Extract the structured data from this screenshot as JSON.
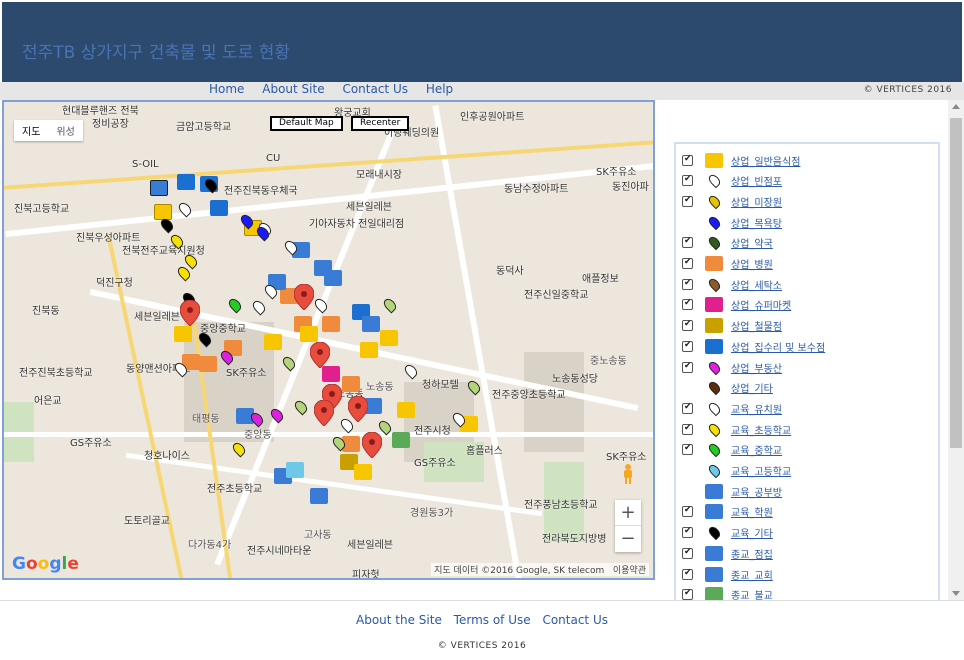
{
  "header": {
    "title": "전주TB 상가지구 건축물 및 도로 현황",
    "bg_color": "#2c4a6e",
    "title_color": "#4a73b5"
  },
  "nav": {
    "items": [
      "Home",
      "About Site",
      "Contact Us",
      "Help"
    ],
    "copyright": "© VERTICES 2016"
  },
  "map": {
    "type_options": [
      "지도",
      "위성"
    ],
    "buttons": {
      "default_map": "Default Map",
      "recenter": "Recenter"
    },
    "labels": [
      "현대블루핸즈 전북",
      "정비공장",
      "금암고등학교",
      "CU",
      "S-OIL",
      "전주진북동우체국",
      "진북고등학교",
      "진북우성아파트",
      "전북전주교육지원청",
      "기아자동차 전일대리점",
      "세븐일레븐",
      "덕진구청",
      "진북동",
      "세븐일레븐",
      "중앙중학교",
      "전주진북초등학교",
      "동양맨션아파트",
      "SK주유소",
      "어은교",
      "GS주유소",
      "청호나이스",
      "태평동",
      "중앙동",
      "전주초등학교",
      "도토리골교",
      "다가동4가",
      "전주시네마타운",
      "고사동",
      "세븐일레븐",
      "피자헛",
      "인후공원아파트",
      "왕궁교회",
      "이랑웨딩의원",
      "SK주유소",
      "동진아파",
      "모래내시장",
      "동남수정아파트",
      "동덕사",
      "애플정보",
      "전주신일중학교",
      "노송동",
      "중노송동",
      "노송동성당",
      "전주중앙초등학교",
      "청하모텔",
      "전주시청",
      "홈플러스",
      "GS주유소",
      "SK주유소",
      "경원동3가",
      "전주풍남초등학교",
      "전라북도지방병",
      "노송동"
    ],
    "attribution": "지도 데이터 ©2016 Google, SK telecom",
    "terms": "이용약관",
    "logo": "Google",
    "zoom_in": "+",
    "zoom_out": "−"
  },
  "legend": {
    "items": [
      {
        "label": "상업_일반음식점",
        "checked": true,
        "icon": "korean-flag-icon",
        "color": "#f7c600"
      },
      {
        "label": "상업_빈점포",
        "checked": true,
        "icon": "white-pin-icon",
        "color": "#ffffff"
      },
      {
        "label": "상업_미장원",
        "checked": true,
        "icon": "yellow-pin-icon",
        "color": "#e6c200"
      },
      {
        "label": "상업_목욕탕",
        "checked": false,
        "icon": "blue-pin-icon",
        "color": "#1a1aff"
      },
      {
        "label": "상업_약국",
        "checked": true,
        "icon": "darkgreen-pin-icon",
        "color": "#2e5d1e"
      },
      {
        "label": "상업_병원",
        "checked": true,
        "icon": "hospital-icon",
        "color": "#f08a3c"
      },
      {
        "label": "상업_세탁소",
        "checked": true,
        "icon": "brown-pin-icon",
        "color": "#8b5a2b"
      },
      {
        "label": "상업_슈퍼마켓",
        "checked": true,
        "icon": "supermarket-icon",
        "color": "#e0208c"
      },
      {
        "label": "상업_철물점",
        "checked": true,
        "icon": "hardware-icon",
        "color": "#c8a000"
      },
      {
        "label": "상업_집수리 및 보수점",
        "checked": true,
        "icon": "house-repair-icon",
        "color": "#1a6fd1"
      },
      {
        "label": "상업_부동산",
        "checked": true,
        "icon": "magenta-pin-icon",
        "color": "#e020e0"
      },
      {
        "label": "상업_기타",
        "checked": false,
        "icon": "darkbrown-pin-icon",
        "color": "#5a2d0c"
      },
      {
        "label": "교육_유치원",
        "checked": true,
        "icon": "white-pin-icon",
        "color": "#ffffff"
      },
      {
        "label": "교육_초등학교",
        "checked": true,
        "icon": "yellow-pin-icon",
        "color": "#f5e000"
      },
      {
        "label": "교육_중학교",
        "checked": true,
        "icon": "green-pin-icon",
        "color": "#22cc22"
      },
      {
        "label": "교육_고등학교",
        "checked": false,
        "icon": "lightblue-pin-icon",
        "color": "#6fc8e8"
      },
      {
        "label": "교육_공부방",
        "checked": false,
        "icon": "study-room-icon",
        "color": "#3a7bd5"
      },
      {
        "label": "교육_학원",
        "checked": true,
        "icon": "academy-icon",
        "color": "#3a7bd5"
      },
      {
        "label": "교육_기타",
        "checked": true,
        "icon": "black-pin-icon",
        "color": "#000000"
      },
      {
        "label": "종교_점집",
        "checked": true,
        "icon": "fortune-icon",
        "color": "#3a7bd5"
      },
      {
        "label": "종교_교회",
        "checked": true,
        "icon": "church-icon",
        "color": "#3a7bd5"
      },
      {
        "label": "종교_불교",
        "checked": true,
        "icon": "temple-icon",
        "color": "#5aaa5a"
      }
    ]
  },
  "footer": {
    "links": [
      "About the Site",
      "Terms of Use",
      "Contact Us"
    ],
    "copyright": "© VERTICES 2016"
  }
}
